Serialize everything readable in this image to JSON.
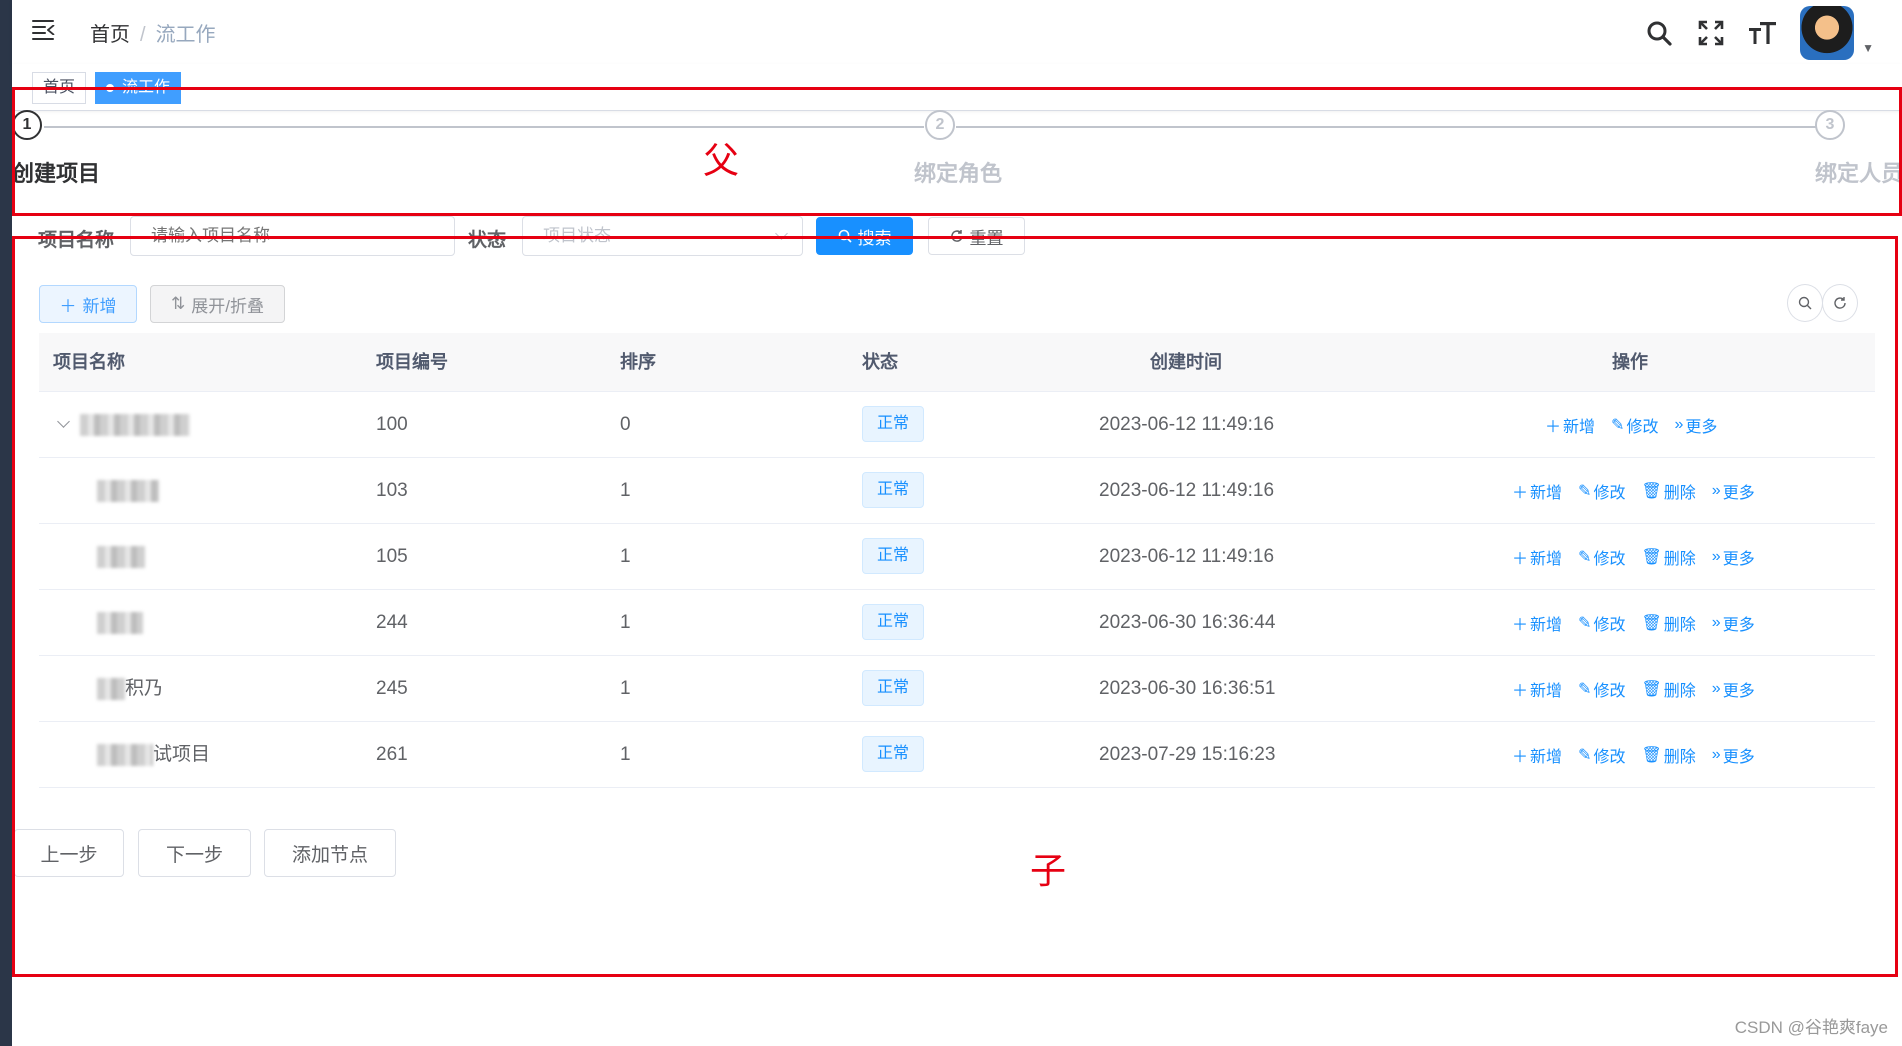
{
  "navbar": {
    "breadcrumb": {
      "home": "首页",
      "separator": "/",
      "current": "流工作"
    },
    "icons": [
      "menu-fold-icon",
      "search-icon",
      "fullscreen-icon",
      "font-size-icon"
    ]
  },
  "tags": {
    "home": "首页",
    "active": "流工作"
  },
  "steps": [
    {
      "number": "1",
      "title": "创建项目",
      "active": true
    },
    {
      "number": "2",
      "title": "绑定角色",
      "active": false
    },
    {
      "number": "3",
      "title": "绑定人员",
      "active": false
    }
  ],
  "annotations": {
    "parent": "父",
    "child": "子",
    "color": "#e60012"
  },
  "search_form": {
    "name_label": "项目名称",
    "name_placeholder": "请输入项目名称",
    "status_label": "状态",
    "status_placeholder": "项目状态",
    "search_button": "搜索",
    "reset_button": "重置"
  },
  "toolbar": {
    "add_button": "新增",
    "expand_button": "展开/折叠"
  },
  "table": {
    "columns": [
      "项目名称",
      "项目编号",
      "排序",
      "状态",
      "创建时间",
      "操作"
    ],
    "rows": [
      {
        "name": "",
        "number": "100",
        "sort": "0",
        "status": "正常",
        "created": "2023-06-12 11:49:16",
        "is_parent": true
      },
      {
        "name": "",
        "number": "103",
        "sort": "1",
        "status": "正常",
        "created": "2023-06-12 11:49:16",
        "is_parent": false
      },
      {
        "name": "",
        "number": "105",
        "sort": "1",
        "status": "正常",
        "created": "2023-06-12 11:49:16",
        "is_parent": false
      },
      {
        "name": "",
        "number": "244",
        "sort": "1",
        "status": "正常",
        "created": "2023-06-30 16:36:44",
        "is_parent": false
      },
      {
        "name": "积乃",
        "number": "245",
        "sort": "1",
        "status": "正常",
        "created": "2023-06-30 16:36:51",
        "is_parent": false
      },
      {
        "name": "试项目",
        "number": "261",
        "sort": "1",
        "status": "正常",
        "created": "2023-07-29 15:16:23",
        "is_parent": false
      }
    ],
    "actions": {
      "add": "新增",
      "edit": "修改",
      "delete": "删除",
      "more": "更多"
    }
  },
  "footer_buttons": {
    "prev": "上一步",
    "next": "下一步",
    "add_node": "添加节点"
  },
  "watermark": "CSDN @谷艳爽faye",
  "colors": {
    "primary": "#1890ff",
    "sidebar": "#2b3648"
  }
}
